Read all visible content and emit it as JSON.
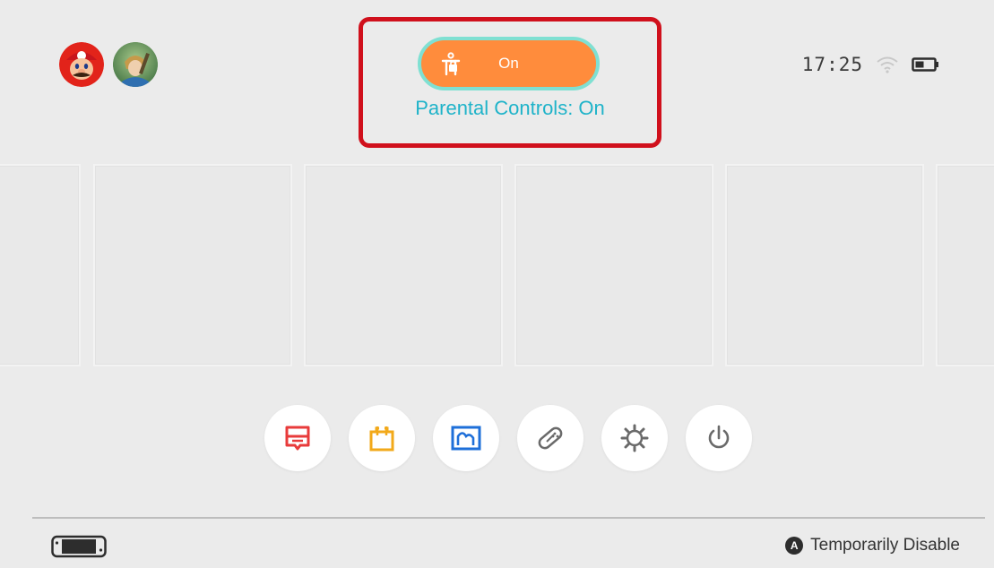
{
  "header": {
    "users": [
      {
        "icon": "mario-avatar-icon"
      },
      {
        "icon": "link-avatar-icon"
      }
    ],
    "parental_controls": {
      "toggle_state": "On",
      "label": "Parental Controls: On",
      "icon": "parental-controls-icon",
      "toggle_color": "#ff8c3c",
      "toggle_border_color": "#7fe0d2",
      "label_color": "#1fb3c9",
      "highlight_box_color": "#d0101c"
    },
    "status": {
      "time": "17:25",
      "wifi_icon": "wifi-icon",
      "battery_icon": "battery-icon"
    }
  },
  "dock": {
    "buttons": [
      {
        "name": "news",
        "icon": "news-icon",
        "color": "#e83b3b"
      },
      {
        "name": "shop",
        "icon": "shop-bag-icon",
        "color": "#f2a91a"
      },
      {
        "name": "album",
        "icon": "album-icon",
        "color": "#1e6fd9"
      },
      {
        "name": "controllers",
        "icon": "controller-icon",
        "color": "#6a6a6a"
      },
      {
        "name": "system-settings",
        "icon": "settings-gear-icon",
        "color": "#6a6a6a"
      },
      {
        "name": "sleep-mode",
        "icon": "power-icon",
        "color": "#6a6a6a"
      }
    ]
  },
  "footer": {
    "console_icon": "console-icon",
    "hint_button": "A",
    "hint_label": "Temporarily Disable"
  }
}
